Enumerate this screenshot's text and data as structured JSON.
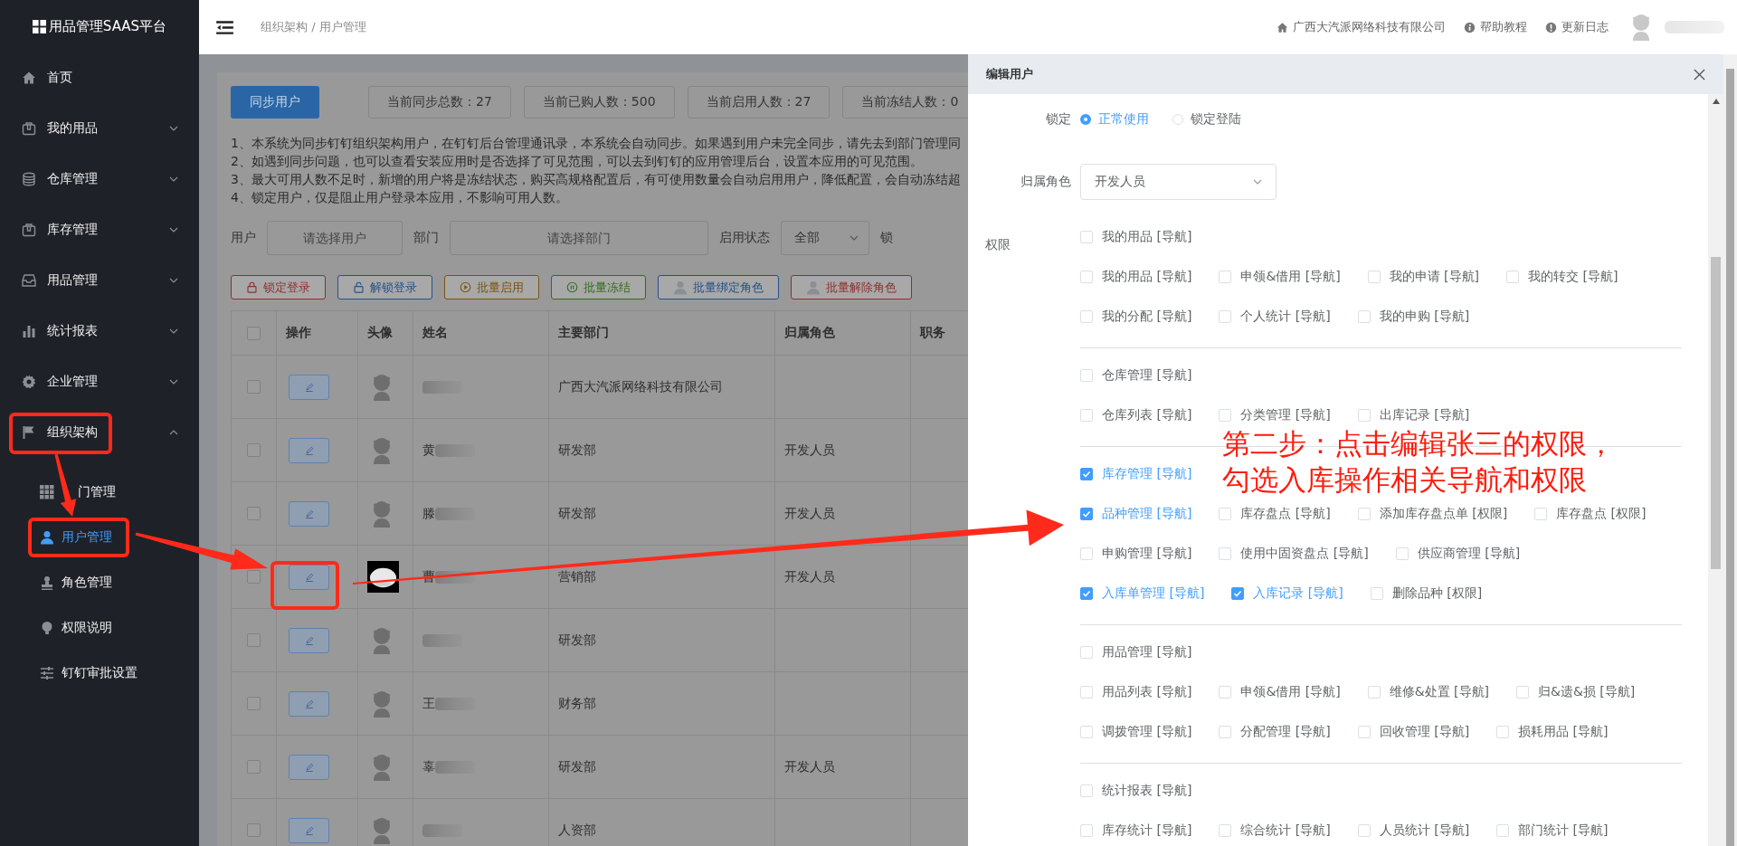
{
  "sidebar": {
    "logo": "用品管理SAAS平台",
    "items": [
      {
        "label": "首页",
        "kind": "link"
      },
      {
        "label": "我的用品",
        "kind": "group",
        "expanded": false
      },
      {
        "label": "仓库管理",
        "kind": "group",
        "expanded": false
      },
      {
        "label": "库存管理",
        "kind": "group",
        "expanded": false
      },
      {
        "label": "用品管理",
        "kind": "group",
        "expanded": false
      },
      {
        "label": "统计报表",
        "kind": "group",
        "expanded": false
      },
      {
        "label": "企业管理",
        "kind": "group",
        "expanded": false
      },
      {
        "label": "组织架构",
        "kind": "group",
        "expanded": true,
        "children": [
          {
            "label": "门管理",
            "selected": false
          },
          {
            "label": "用户管理",
            "selected": true
          },
          {
            "label": "角色管理",
            "selected": false
          },
          {
            "label": "权限说明",
            "selected": false
          },
          {
            "label": "钉钉审批设置",
            "selected": false
          }
        ]
      }
    ]
  },
  "header": {
    "breadcrumb": "组织架构 / 用户管理",
    "company": "广西大汽派网络科技有限公司",
    "links": [
      "帮助教程",
      "更新日志"
    ]
  },
  "main": {
    "sync_button": "同步用户",
    "stats": [
      "当前同步总数：27",
      "当前已购人数：500",
      "当前启用人数：27",
      "当前冻结人数：0"
    ],
    "notes": [
      "1、本系统为同步钉钉组织架构用户，在钉钉后台管理通讯录，本系统会自动同步。如果遇到用户未完全同步，请先去到部门管理同",
      "2、如遇到同步问题，也可以查看安装应用时是否选择了可见范围，可以去到钉钉的应用管理后台，设置本应用的可见范围。",
      "3、最大可用人数不足时，新增的用户将是冻结状态，购买高规格配置后，有可使用数量会自动启用用户，降低配置，会自动冻结超",
      "4、锁定用户，仅是阻止用户登录本应用，不影响可用人数。"
    ],
    "filters": [
      {
        "kind": "input",
        "label": "用户",
        "placeholder": "请选择用户"
      },
      {
        "kind": "input",
        "label": "部门",
        "placeholder": "请选择部门"
      },
      {
        "kind": "select",
        "label": "启用状态",
        "value": "全部"
      },
      {
        "kind": "label",
        "label": "锁"
      }
    ],
    "batch_buttons": [
      {
        "label": "锁定登录",
        "color": "#8e2f2f"
      },
      {
        "label": "解锁登录",
        "color": "#24528a"
      },
      {
        "label": "批量启用",
        "color": "#7a5410"
      },
      {
        "label": "批量冻结",
        "color": "#336d1a"
      },
      {
        "label": "批量绑定角色",
        "color": "#24528a"
      },
      {
        "label": "批量解除角色",
        "color": "#8e2f2f"
      }
    ],
    "table": {
      "all_checked": false,
      "columns": [
        "操作",
        "头像",
        "姓名",
        "主要部门",
        "归属角色",
        "职务"
      ],
      "rows": [
        {
          "checked": false,
          "kind": "default",
          "department": "广西大汽派网络科技有限公司"
        },
        {
          "checked": false,
          "kind": "default",
          "name": "黄",
          "department": "研发部",
          "role": "开发人员"
        },
        {
          "checked": false,
          "kind": "default",
          "name": "滕",
          "department": "研发部",
          "role": "开发人员"
        },
        {
          "checked": false,
          "kind": "picture",
          "name": "曹",
          "department": "营销部",
          "role": "开发人员"
        },
        {
          "checked": false,
          "kind": "default",
          "department": "研发部"
        },
        {
          "checked": false,
          "kind": "default",
          "name": "王",
          "department": "财务部"
        },
        {
          "checked": false,
          "kind": "default",
          "name": "辜",
          "department": "研发部",
          "role": "开发人员"
        },
        {
          "checked": false,
          "kind": "default",
          "department": "人资部"
        }
      ]
    }
  },
  "drawer": {
    "title": "编辑用户",
    "lock": {
      "label": "锁定",
      "options": [
        {
          "label": "正常使用",
          "selected": true
        },
        {
          "label": "锁定登陆",
          "selected": false
        }
      ]
    },
    "role": {
      "label": "归属角色",
      "value": "开发人员"
    },
    "permissions": {
      "label": "权限",
      "groups": [
        {
          "rows": [
            [
              {
                "label": "我的用品 [导航]",
                "checked": false
              }
            ],
            [
              {
                "label": "我的用品 [导航]",
                "checked": false
              },
              {
                "label": "申领&借用 [导航]",
                "checked": false
              },
              {
                "label": "我的申请 [导航]",
                "checked": false
              },
              {
                "label": "我的转交 [导航]",
                "checked": false
              }
            ],
            [
              {
                "label": "我的分配 [导航]",
                "checked": false
              },
              {
                "label": "个人统计 [导航]",
                "checked": false
              },
              {
                "label": "我的申购 [导航]",
                "checked": false
              }
            ]
          ]
        },
        {
          "rows": [
            [
              {
                "label": "仓库管理 [导航]",
                "checked": false
              }
            ],
            [
              {
                "label": "仓库列表 [导航]",
                "checked": false
              },
              {
                "label": "分类管理 [导航]",
                "checked": false
              },
              {
                "label": "出库记录 [导航]",
                "checked": false
              }
            ]
          ]
        },
        {
          "rows": [
            [
              {
                "label": "库存管理 [导航]",
                "checked": true
              }
            ],
            [
              {
                "label": "品种管理 [导航]",
                "checked": true
              },
              {
                "label": "库存盘点 [导航]",
                "checked": false
              },
              {
                "label": "添加库存盘点单 [权限]",
                "checked": false
              },
              {
                "label": "库存盘点 [权限]",
                "checked": false
              }
            ],
            [
              {
                "label": "申购管理 [导航]",
                "checked": false
              },
              {
                "label": "使用中固资盘点 [导航]",
                "checked": false
              },
              {
                "label": "供应商管理 [导航]",
                "checked": false
              }
            ],
            [
              {
                "label": "入库单管理 [导航]",
                "checked": true
              },
              {
                "label": "入库记录 [导航]",
                "checked": true
              },
              {
                "label": "删除品种 [权限]",
                "checked": false
              }
            ]
          ]
        },
        {
          "rows": [
            [
              {
                "label": "用品管理 [导航]",
                "checked": false
              }
            ],
            [
              {
                "label": "用品列表 [导航]",
                "checked": false
              },
              {
                "label": "申领&借用 [导航]",
                "checked": false
              },
              {
                "label": "维修&处置 [导航]",
                "checked": false
              },
              {
                "label": "归&遗&损 [导航]",
                "checked": false
              }
            ],
            [
              {
                "label": "调拨管理 [导航]",
                "checked": false
              },
              {
                "label": "分配管理 [导航]",
                "checked": false
              },
              {
                "label": "回收管理 [导航]",
                "checked": false
              },
              {
                "label": "损耗用品 [导航]",
                "checked": false
              }
            ]
          ]
        },
        {
          "rows": [
            [
              {
                "label": "统计报表 [导航]",
                "checked": false
              }
            ],
            [
              {
                "label": "库存统计 [导航]",
                "checked": false
              },
              {
                "label": "综合统计 [导航]",
                "checked": false
              },
              {
                "label": "人员统计 [导航]",
                "checked": false
              },
              {
                "label": "部门统计 [导航]",
                "checked": false
              }
            ]
          ]
        }
      ]
    }
  },
  "annotation": {
    "lines": [
      "第二步：点击编辑张三的权限，",
      "勾选入库操作相关导航和权限"
    ]
  }
}
